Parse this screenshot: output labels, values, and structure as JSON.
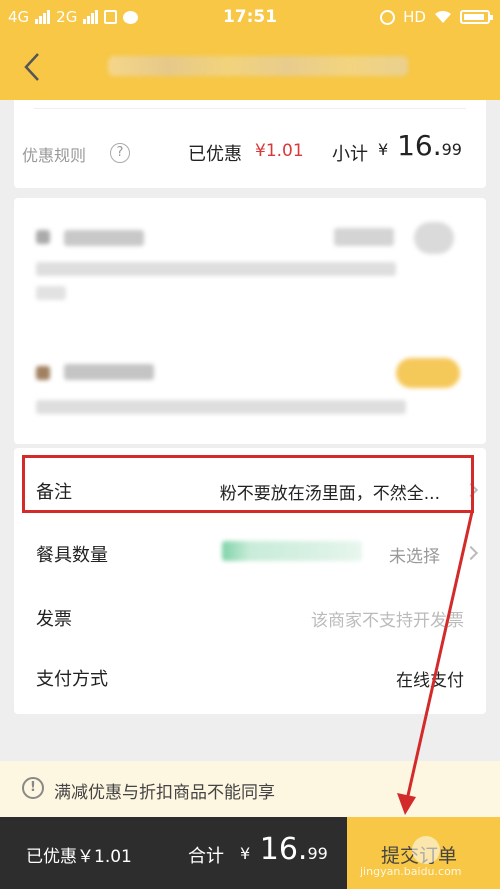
{
  "status_bar": {
    "net1": "4G",
    "net2": "2G",
    "time": "17:51",
    "hd": "HD"
  },
  "header": {
    "back_icon": "chevron-left-icon",
    "title_blurred": true
  },
  "summary": {
    "rule_label": "优惠规则",
    "help_symbol": "?",
    "discount_label": "已优惠",
    "discount_value": "¥1.01",
    "subtotal_label": "小计",
    "subtotal_currency": "¥",
    "subtotal_int": "16.",
    "subtotal_dec": "99"
  },
  "options": {
    "remark_label": "备注",
    "remark_value": "粉不要放在汤里面，不然全...",
    "tableware_label": "餐具数量",
    "tableware_value": "未选择",
    "invoice_label": "发票",
    "invoice_value": "该商家不支持开发票",
    "payment_label": "支付方式",
    "payment_value": "在线支付"
  },
  "notice": {
    "icon_symbol": "!",
    "text": "满减优惠与折扣商品不能同享"
  },
  "bottom_bar": {
    "discount_text": "已优惠￥1.01",
    "total_label": "合计",
    "total_currency": "¥",
    "total_int": "16.",
    "total_dec": "99",
    "submit_label": "提交订单",
    "watermark": "jingyan.baidu.com"
  },
  "colors": {
    "brand_yellow": "#f7c745",
    "discount_red": "#d9393a",
    "annotation_red": "#d32a2a",
    "bottom_bar": "#2d2d2d"
  }
}
